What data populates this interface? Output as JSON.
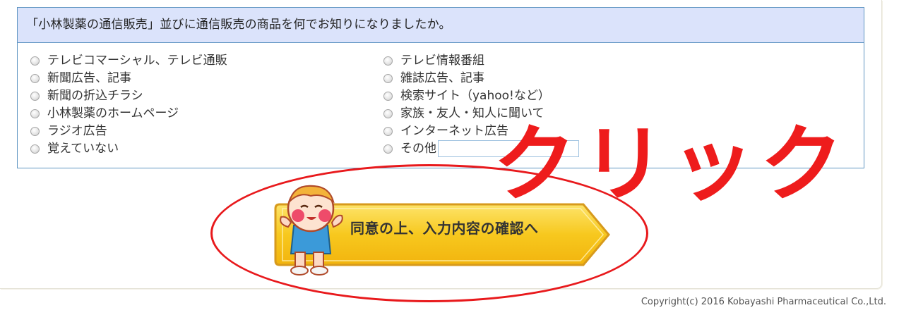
{
  "question": {
    "title": "「小林製薬の通信販売」並びに通信販売の商品を何でお知りになりましたか。",
    "options_left": [
      "テレビコマーシャル、テレビ通販",
      "新聞広告、記事",
      "新聞の折込チラシ",
      "小林製薬のホームページ",
      "ラジオ広告",
      "覚えていない"
    ],
    "options_right": [
      "テレビ情報番組",
      "雑誌広告、記事",
      "検索サイト（yahoo!など）",
      "家族・友人・知人に聞いて",
      "インターネット広告",
      "その他"
    ],
    "other_input_value": ""
  },
  "annotation": {
    "click_label": "クリック",
    "color": "#ee1c1c"
  },
  "confirm_button": {
    "label": "同意の上、入力内容の確認へ",
    "color": "#f7c81e"
  },
  "footer": {
    "copyright": "Copyright(c) 2016 Kobayashi Pharmaceutical Co.,Ltd."
  },
  "colors": {
    "header_bg": "#dbe3fb",
    "border": "#5f95c2"
  }
}
